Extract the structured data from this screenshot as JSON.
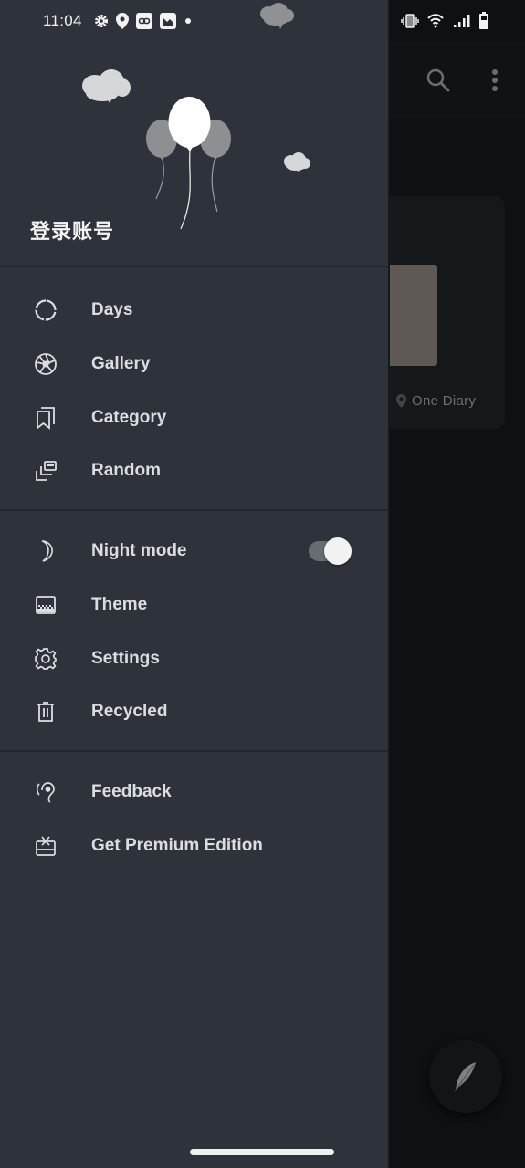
{
  "status_bar": {
    "time": "11:04",
    "left_icons": [
      "gear-icon",
      "location-pin-icon",
      "link-app-icon",
      "mail-app-icon",
      "dot-icon"
    ],
    "right_icons": [
      "vibrate-icon",
      "wifi-icon",
      "signal-icon",
      "battery-icon"
    ]
  },
  "background_app": {
    "location_label": "One Diary",
    "toolbar_icons": [
      "search-icon",
      "more-vert-icon"
    ],
    "fab_icon": "feather-icon"
  },
  "drawer": {
    "header": {
      "login_label": "登录账号"
    },
    "sections": [
      {
        "items": [
          {
            "icon": "days-ring-icon",
            "label": "Days"
          },
          {
            "icon": "aperture-icon",
            "label": "Gallery"
          },
          {
            "icon": "bookmarks-icon",
            "label": "Category"
          },
          {
            "icon": "random-cards-icon",
            "label": "Random"
          }
        ]
      },
      {
        "items": [
          {
            "icon": "moon-icon",
            "label": "Night mode",
            "toggle": true
          },
          {
            "icon": "theme-icon",
            "label": "Theme"
          },
          {
            "icon": "gear-icon",
            "label": "Settings"
          },
          {
            "icon": "trash-icon",
            "label": "Recycled"
          }
        ]
      },
      {
        "items": [
          {
            "icon": "ear-icon",
            "label": "Feedback"
          },
          {
            "icon": "gift-card-icon",
            "label": "Get Premium Edition"
          }
        ]
      }
    ],
    "night_mode_enabled": true
  },
  "colors": {
    "drawer_bg": "#2e323a",
    "scrim_bg": "#0d1114",
    "label_text": "#dcdde0",
    "toggle_track": "#686d74",
    "toggle_thumb": "#f2f2f2"
  }
}
